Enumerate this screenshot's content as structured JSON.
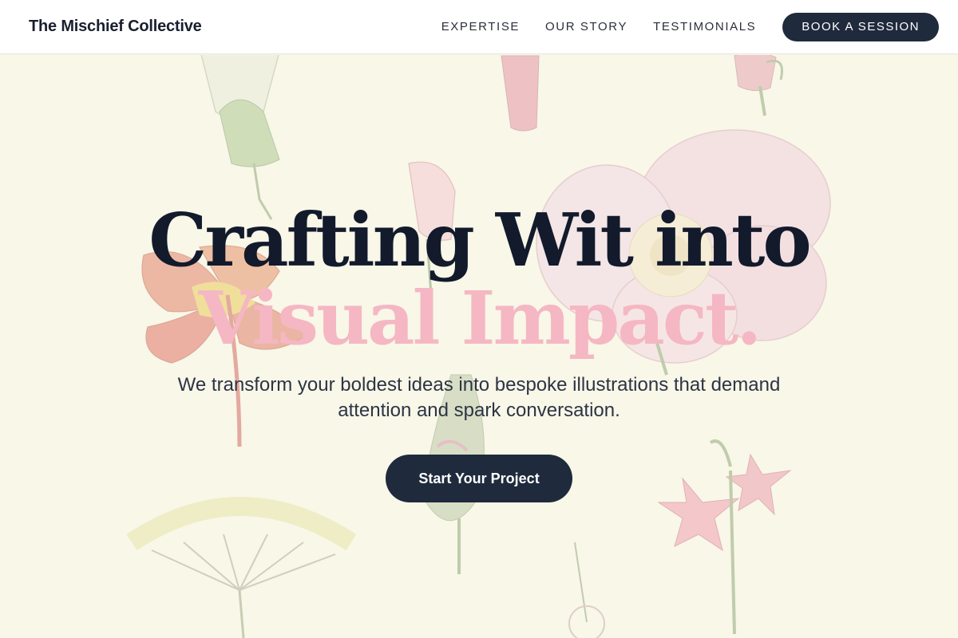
{
  "header": {
    "brand": "The Mischief Collective",
    "nav": [
      "EXPERTISE",
      "OUR STORY",
      "TESTIMONIALS"
    ],
    "cta_label": "BOOK A SESSION"
  },
  "hero": {
    "headline_line1": "Crafting Wit into",
    "headline_line2": "Visual Impact.",
    "subtitle": "We transform your boldest ideas into bespoke illustrations that demand attention and spark conversation.",
    "cta_label": "Start Your Project"
  },
  "colors": {
    "navy": "#1f2a3d",
    "headline_dark": "#121a2c",
    "headline_pink": "#f5b7c3",
    "background_cream": "#f8f7e7"
  },
  "icons": [
    "botanical-background-illustration"
  ]
}
